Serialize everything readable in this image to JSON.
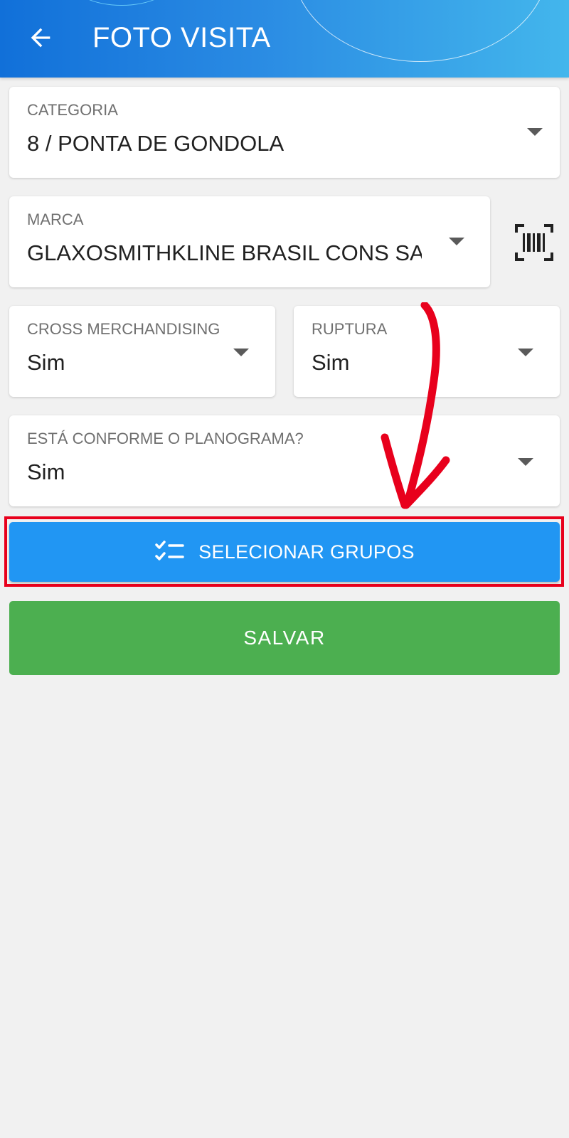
{
  "header": {
    "title": "FOTO VISITA",
    "back_icon": "arrow-left-icon",
    "background_start": "#1170d9",
    "background_end": "#43b6ec"
  },
  "form": {
    "categoria": {
      "label": "CATEGORIA",
      "value": "8 / PONTA DE GONDOLA"
    },
    "marca": {
      "label": "MARCA",
      "value": "GLAXOSMITHKLINE BRASIL CONS SAU"
    },
    "barcode_icon": "barcode-scan-icon",
    "cross_merchandising": {
      "label": "CROSS MERCHANDISING",
      "value": "Sim"
    },
    "ruptura": {
      "label": "RUPTURA",
      "value": "Sim"
    },
    "planograma": {
      "label": "ESTÁ CONFORME O PLANOGRAMA?",
      "value": "Sim"
    }
  },
  "actions": {
    "select_groups_label": "SELECIONAR GRUPOS",
    "select_groups_icon": "checklist-icon",
    "select_groups_color": "#2196f3",
    "save_label": "SALVAR",
    "save_color": "#4caf50"
  },
  "annotation": {
    "arrow_color": "#e8001c",
    "highlight_color": "#e8001c"
  }
}
